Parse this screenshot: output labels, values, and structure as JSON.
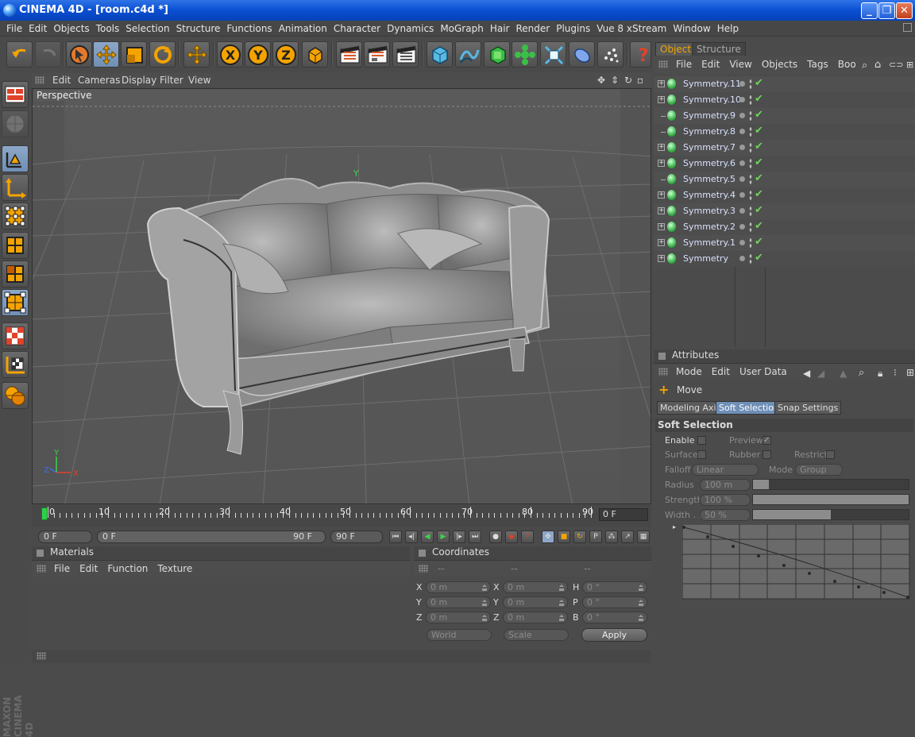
{
  "window": {
    "title": "CINEMA 4D - [room.c4d *]",
    "minimize": "_",
    "maximize": "❐",
    "close": "✕"
  },
  "menu": [
    "File",
    "Edit",
    "Objects",
    "Tools",
    "Selection",
    "Structure",
    "Functions",
    "Animation",
    "Character",
    "Dynamics",
    "MoGraph",
    "Hair",
    "Render",
    "Plugins",
    "Vue 8 xStream",
    "Window",
    "Help"
  ],
  "toolbar": {
    "buttons": [
      "undo-icon",
      "redo-icon",
      "live-selection-icon",
      "move-icon",
      "scale-icon",
      "rotate-icon",
      "last-tool-icon",
      "x-axis-icon",
      "y-axis-icon",
      "z-axis-icon",
      "coordinate-system-icon",
      "render-view-icon",
      "render-picture-viewer-icon",
      "render-settings-icon",
      "cube-icon",
      "spline-pen-icon",
      "nurbs-icon",
      "array-icon",
      "deformer-icon",
      "scene-icon",
      "camera-icon",
      "light-icon",
      "help-icon"
    ]
  },
  "viewport": {
    "menu": [
      "Edit",
      "Cameras",
      "Display",
      "Filter",
      "View"
    ],
    "label": "Perspective",
    "axis": {
      "x": "X",
      "y": "Y",
      "z": "Z"
    },
    "colors": {
      "background": "#5d5d5d",
      "grid": "#6e6e6e",
      "sofa": "#9a9a9a"
    }
  },
  "timeline": {
    "labels": [
      "0",
      "10",
      "20",
      "30",
      "40",
      "50",
      "60",
      "70",
      "80",
      "90"
    ],
    "current_frame": "0 F"
  },
  "playback": {
    "start": "0 F",
    "range_start": "0 F",
    "range_end": "90 F",
    "end": "90 F"
  },
  "materials": {
    "title": "Materials",
    "menu": [
      "File",
      "Edit",
      "Function",
      "Texture"
    ]
  },
  "coordinates": {
    "title": "Coordinates",
    "headers": [
      "--",
      "--",
      "--"
    ],
    "rows": [
      {
        "l1": "X",
        "v1": "0 m",
        "l2": "X",
        "v2": "0 m",
        "l3": "H",
        "v3": "0 °"
      },
      {
        "l1": "Y",
        "v1": "0 m",
        "l2": "Y",
        "v2": "0 m",
        "l3": "P",
        "v3": "0 °"
      },
      {
        "l1": "Z",
        "v1": "0 m",
        "l2": "Z",
        "v2": "0 m",
        "l3": "B",
        "v3": "0 °"
      }
    ],
    "space": "World",
    "mode": "Scale",
    "apply": "Apply"
  },
  "objects": {
    "tabs": [
      "Objects",
      "Structure"
    ],
    "menu": [
      "File",
      "Edit",
      "View",
      "Objects",
      "Tags",
      "Boo"
    ],
    "items": [
      {
        "name": "Symmetry.11",
        "expand": true
      },
      {
        "name": "Symmetry.10",
        "expand": true
      },
      {
        "name": "Symmetry.9",
        "expand": false
      },
      {
        "name": "Symmetry.8",
        "expand": false
      },
      {
        "name": "Symmetry.7",
        "expand": true
      },
      {
        "name": "Symmetry.6",
        "expand": true
      },
      {
        "name": "Symmetry.5",
        "expand": false
      },
      {
        "name": "Symmetry.4",
        "expand": true
      },
      {
        "name": "Symmetry.3",
        "expand": true
      },
      {
        "name": "Symmetry.2",
        "expand": true
      },
      {
        "name": "Symmetry.1",
        "expand": true
      },
      {
        "name": "Symmetry",
        "expand": true
      }
    ]
  },
  "attributes": {
    "title": "Attributes",
    "menu": [
      "Mode",
      "Edit",
      "User Data"
    ],
    "tool": "Move",
    "tabs": [
      "Modeling Axis",
      "Soft Selection",
      "Snap Settings"
    ],
    "section": "Soft Selection",
    "enable": "Enable",
    "preview": "Preview",
    "surface": "Surface",
    "rubber": "Rubber",
    "restrict": "Restrict",
    "falloff_label": "Falloff",
    "falloff": "Linear",
    "mode_label": "Mode",
    "mode": "Group",
    "radius_label": "Radius",
    "radius": "100 m",
    "strength_label": "Strength",
    "strength": "100 %",
    "width_label": "Width . .",
    "width": "50 %",
    "strength_level": 1.0,
    "width_level": 0.5
  }
}
